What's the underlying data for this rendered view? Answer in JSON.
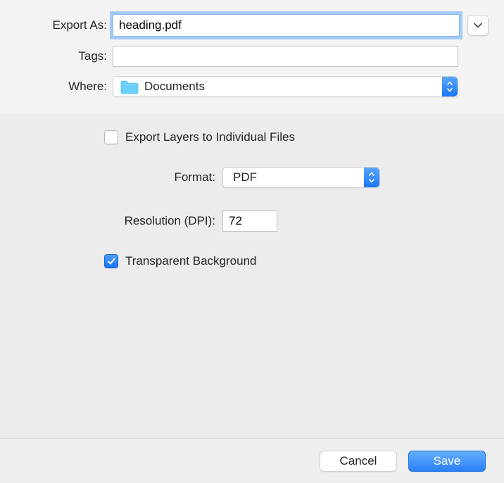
{
  "labels": {
    "export_as": "Export As:",
    "tags": "Tags:",
    "where": "Where:",
    "format": "Format:",
    "resolution": "Resolution (DPI):"
  },
  "fields": {
    "filename": "heading.pdf",
    "tags": "",
    "where": "Documents",
    "format": "PDF",
    "resolution": "72"
  },
  "options": {
    "export_layers_label": "Export Layers to Individual Files",
    "export_layers_checked": false,
    "transparent_bg_label": "Transparent Background",
    "transparent_bg_checked": true
  },
  "buttons": {
    "cancel": "Cancel",
    "save": "Save"
  }
}
